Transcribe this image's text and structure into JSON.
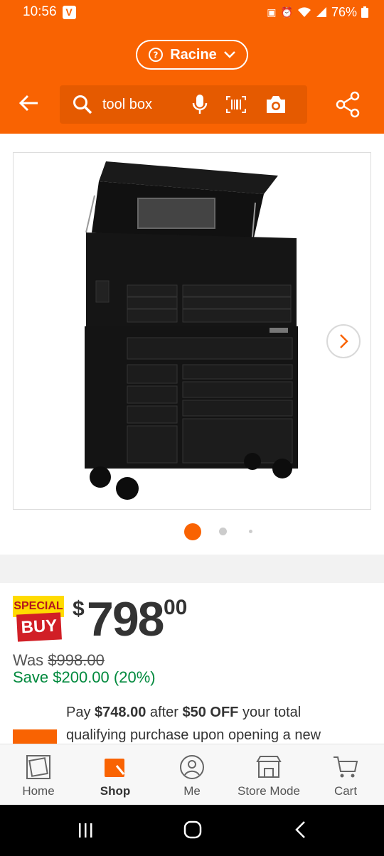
{
  "status_bar": {
    "time": "10:56",
    "vpn_glyph": "V",
    "battery": "76%"
  },
  "header": {
    "store_name": "Racine",
    "search_query": "tool box",
    "colors": {
      "brand": "#f96302"
    }
  },
  "gallery": {
    "image_alt": "Black rolling tool chest with open lid",
    "page_count": 3,
    "current_page": 1
  },
  "product": {
    "badge_top": "SPECIAL",
    "badge_bottom": "BUY",
    "price_symbol": "$",
    "price_dollars": "798",
    "price_cents": "00",
    "was_label": "Was",
    "was_price": "$998.00",
    "save_text": "Save $200.00 (20%)"
  },
  "promo": {
    "pay_prefix": "Pay",
    "pay_amount": "$748.00",
    "after_text": "after",
    "discount": "$50 OFF",
    "rest_line1": "your total",
    "line2": "qualifying purchase upon opening a new"
  },
  "bottom_nav": {
    "items": [
      {
        "label": "Home",
        "icon": "home-depot-logo-icon"
      },
      {
        "label": "Shop",
        "icon": "shop-bag-icon"
      },
      {
        "label": "Me",
        "icon": "person-icon"
      },
      {
        "label": "Store Mode",
        "icon": "store-icon"
      },
      {
        "label": "Cart",
        "icon": "cart-icon"
      }
    ],
    "active": "Shop"
  }
}
